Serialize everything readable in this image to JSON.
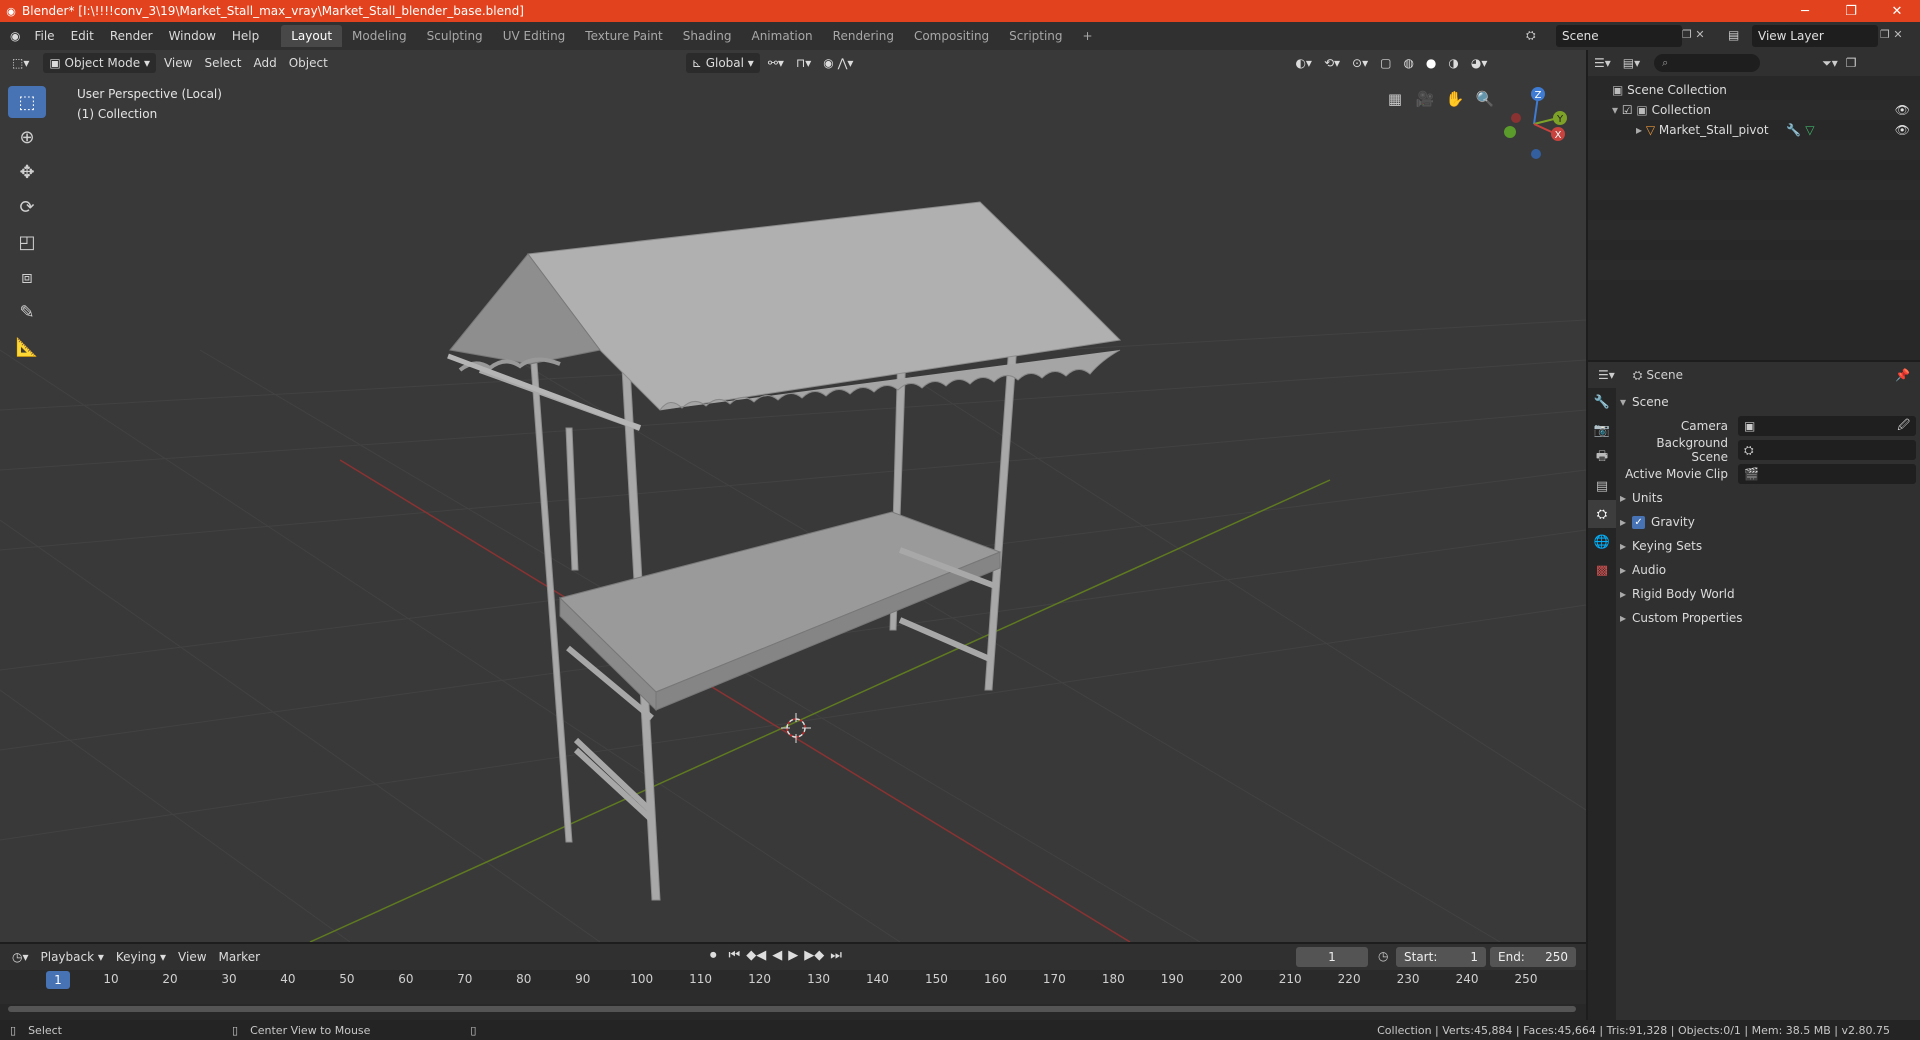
{
  "title_bar": {
    "text": "Blender* [I:\\!!!!conv_3\\19\\Market_Stall_max_vray\\Market_Stall_blender_base.blend]",
    "minimize": "─",
    "maximize": "❐",
    "close": "✕"
  },
  "menu": [
    "File",
    "Edit",
    "Render",
    "Window",
    "Help"
  ],
  "workspaces": [
    "Layout",
    "Modeling",
    "Sculpting",
    "UV Editing",
    "Texture Paint",
    "Shading",
    "Animation",
    "Rendering",
    "Compositing",
    "Scripting"
  ],
  "active_workspace": "Layout",
  "scene_name": "Scene",
  "view_layer": "View Layer",
  "viewport": {
    "mode": "Object Mode",
    "menus": [
      "View",
      "Select",
      "Add",
      "Object"
    ],
    "orientation": "Global",
    "info_line1": "User Perspective (Local)",
    "info_line2": "(1) Collection",
    "gizmo_axes": {
      "x": "X",
      "y": "Y",
      "z": "Z"
    }
  },
  "outliner": {
    "root": "Scene Collection",
    "collection": "Collection",
    "object": "Market_Stall_pivot"
  },
  "properties": {
    "header": "Scene",
    "panel": "Scene",
    "camera_label": "Camera",
    "background_scene_label": "Background Scene",
    "active_movie_clip_label": "Active Movie Clip",
    "sections": [
      "Units",
      "Gravity",
      "Keying Sets",
      "Audio",
      "Rigid Body World",
      "Custom Properties"
    ]
  },
  "timeline": {
    "menus": [
      "Playback",
      "Keying",
      "View",
      "Marker"
    ],
    "current_frame": "1",
    "start_label": "Start:",
    "start_value": "1",
    "end_label": "End:",
    "end_value": "250",
    "ruler_marks": [
      "1",
      "10",
      "20",
      "30",
      "40",
      "50",
      "60",
      "70",
      "80",
      "90",
      "100",
      "110",
      "120",
      "130",
      "140",
      "150",
      "160",
      "170",
      "180",
      "190",
      "200",
      "210",
      "220",
      "230",
      "240",
      "250"
    ]
  },
  "status_bar": {
    "left_action": "Select",
    "middle_action": "Center View to Mouse",
    "stats": "Collection | Verts:45,884 | Faces:45,664 | Tris:91,328 | Objects:0/1 | Mem: 38.5 MB | v2.80.75"
  },
  "colors": {
    "title_bar": "#e2421d",
    "accent": "#4772b3",
    "axis_x": "#c8423e",
    "axis_y": "#7da227",
    "axis_z": "#3f7bd3"
  }
}
